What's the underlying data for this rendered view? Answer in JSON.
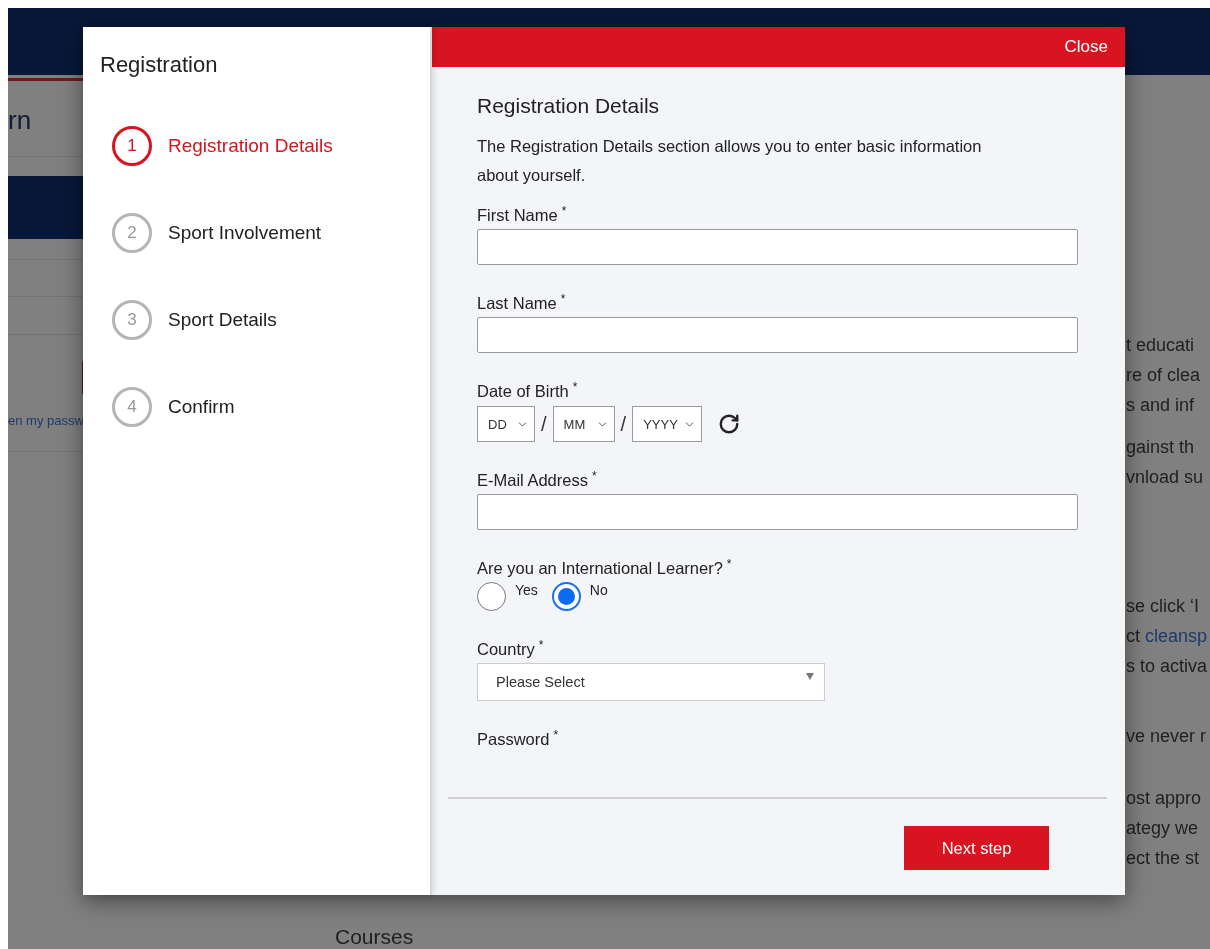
{
  "background": {
    "page_title": "rn",
    "forgot_link": "en my passw",
    "paragraphs": [
      [
        {
          "text": "t educati"
        },
        {
          "text": "re of clea"
        },
        {
          "text": "s and inf"
        }
      ],
      [
        {
          "text": "gainst th"
        },
        {
          "text": "vnload su"
        }
      ],
      [
        {
          "text": "se click ‘I"
        },
        {
          "text": "ct",
          "link": "cleansp"
        },
        {
          "text": "s to activa"
        }
      ],
      [
        {
          "text": "ve never r"
        }
      ],
      [
        {
          "text": "ost appro"
        },
        {
          "text": "ategy we"
        },
        {
          "text": "ect the st"
        }
      ]
    ],
    "section_heading": "Courses"
  },
  "modal": {
    "title": "Registration",
    "steps": [
      {
        "number": "1",
        "label": "Registration Details",
        "selected": true
      },
      {
        "number": "2",
        "label": "Sport Involvement",
        "selected": false
      },
      {
        "number": "3",
        "label": "Sport Details",
        "selected": false
      },
      {
        "number": "4",
        "label": "Confirm",
        "selected": false
      }
    ],
    "close": "Close",
    "section_title": "Registration Details",
    "description": "The Registration Details section allows you to enter basic information about yourself.",
    "fields": [
      {
        "kind": "text",
        "label": "First Name",
        "required_mark": "*"
      },
      {
        "kind": "text",
        "label": "Last Name",
        "required_mark": "*"
      },
      {
        "kind": "date",
        "label": "Date of Birth",
        "required_mark": "*",
        "separator": "/",
        "parts": [
          {
            "value": "DD"
          },
          {
            "value": "MM"
          },
          {
            "value": "YYYY"
          }
        ]
      },
      {
        "kind": "text",
        "label": "E-Mail Address",
        "required_mark": "*"
      },
      {
        "kind": "radio",
        "label": "Are you an International Learner?",
        "required_mark": "*",
        "options": [
          {
            "label": "Yes",
            "selected": false
          },
          {
            "label": "No",
            "selected": true
          }
        ]
      },
      {
        "kind": "select",
        "label": "Country",
        "required_mark": "*",
        "value": "Please Select"
      },
      {
        "kind": "label",
        "label": "Password",
        "required_mark": "*"
      }
    ],
    "next_button": "Next step"
  }
}
